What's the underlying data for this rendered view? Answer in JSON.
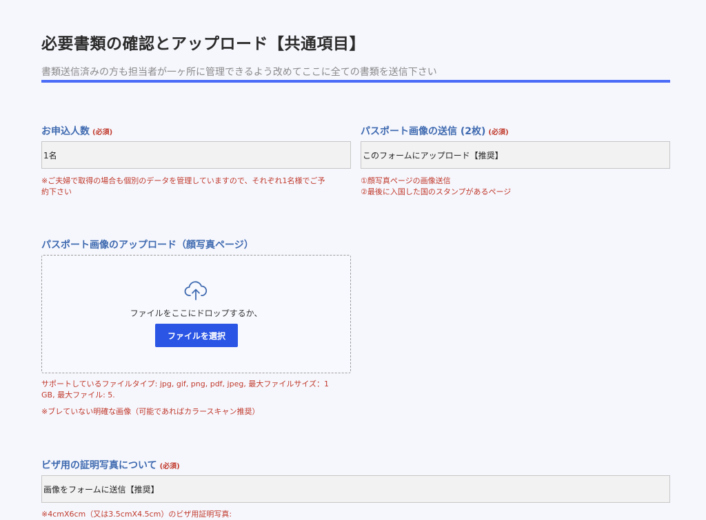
{
  "header": {
    "title": "必要書類の確認とアップロード【共通項目】",
    "subtitle": "書類送信済みの方も担当者が一ヶ所に管理できるよう改めてここに全ての書類を送信下さい"
  },
  "required_mark": "(必須)",
  "applicants": {
    "label": "お申込人数",
    "value": "1名",
    "note_line1": "※ご夫婦で取得の場合も個別のデータを管理していますので、それぞれ1名様でご予",
    "note_line2": "約下さい"
  },
  "passport_send": {
    "label": "パスポート画像の送信 (2枚)",
    "value": "このフォームにアップロード【推奨】",
    "note_line1": "①顔写真ページの画像送信",
    "note_line2": "②最後に入国した国のスタンプがあるページ"
  },
  "passport_upload": {
    "label": "パスポート画像のアップロード（顔写真ページ）",
    "drop_text": "ファイルをここにドロップするか、",
    "button_label": "ファイルを選択",
    "icon": "cloud-upload-icon",
    "support_line1": "サポートしているファイルタイプ: jpg, gif, png, pdf, jpeg, 最大ファイルサイズ：1",
    "support_line2": "GB, 最大ファイル: 5.",
    "quality_note": "※ブレていない明確な画像（可能であればカラースキャン推奨）"
  },
  "visa_photo": {
    "label": "ビザ用の証明写真について",
    "value": "画像をフォームに送信【推奨】",
    "note_line1": "※4cmX6cm（又は3.5cmX4.5cm）のビザ用証明写真:"
  },
  "colors": {
    "accent": "#4a6cf7",
    "label": "#3f6ab0",
    "required": "#c0392b",
    "button": "#2a55e5"
  }
}
